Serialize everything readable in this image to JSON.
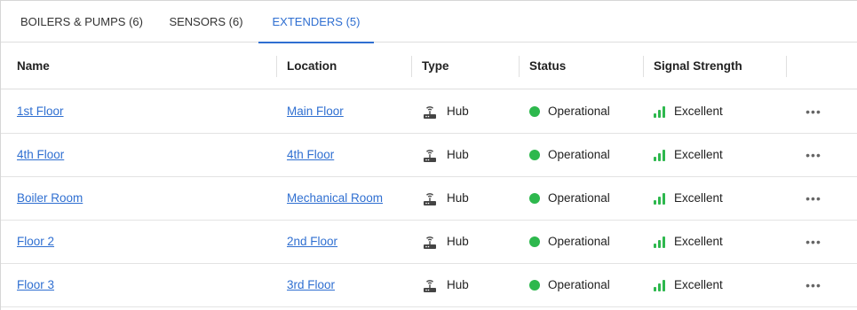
{
  "tabs": [
    {
      "label": "BOILERS & PUMPS (6)",
      "active": false
    },
    {
      "label": "SENSORS (6)",
      "active": false
    },
    {
      "label": "EXTENDERS (5)",
      "active": true
    }
  ],
  "table": {
    "columns": [
      "Name",
      "Location",
      "Type",
      "Status",
      "Signal Strength"
    ],
    "rows": [
      {
        "name": "1st Floor",
        "location": "Main Floor",
        "type": "Hub",
        "status": "Operational",
        "signal": "Excellent"
      },
      {
        "name": "4th Floor",
        "location": "4th Floor",
        "type": "Hub",
        "status": "Operational",
        "signal": "Excellent"
      },
      {
        "name": "Boiler Room",
        "location": "Mechanical Room",
        "type": "Hub",
        "status": "Operational",
        "signal": "Excellent"
      },
      {
        "name": "Floor 2",
        "location": "2nd Floor",
        "type": "Hub",
        "status": "Operational",
        "signal": "Excellent"
      },
      {
        "name": "Floor 3",
        "location": "3rd Floor",
        "type": "Hub",
        "status": "Operational",
        "signal": "Excellent"
      }
    ],
    "more_label": "•••"
  },
  "icons": {
    "type": "hub-icon",
    "status": "status-dot-icon",
    "signal": "signal-bars-icon",
    "more": "more-options-icon"
  },
  "colors": {
    "accent": "#2f6fd1",
    "operational": "#2db84d",
    "signal": "#2db84d"
  }
}
